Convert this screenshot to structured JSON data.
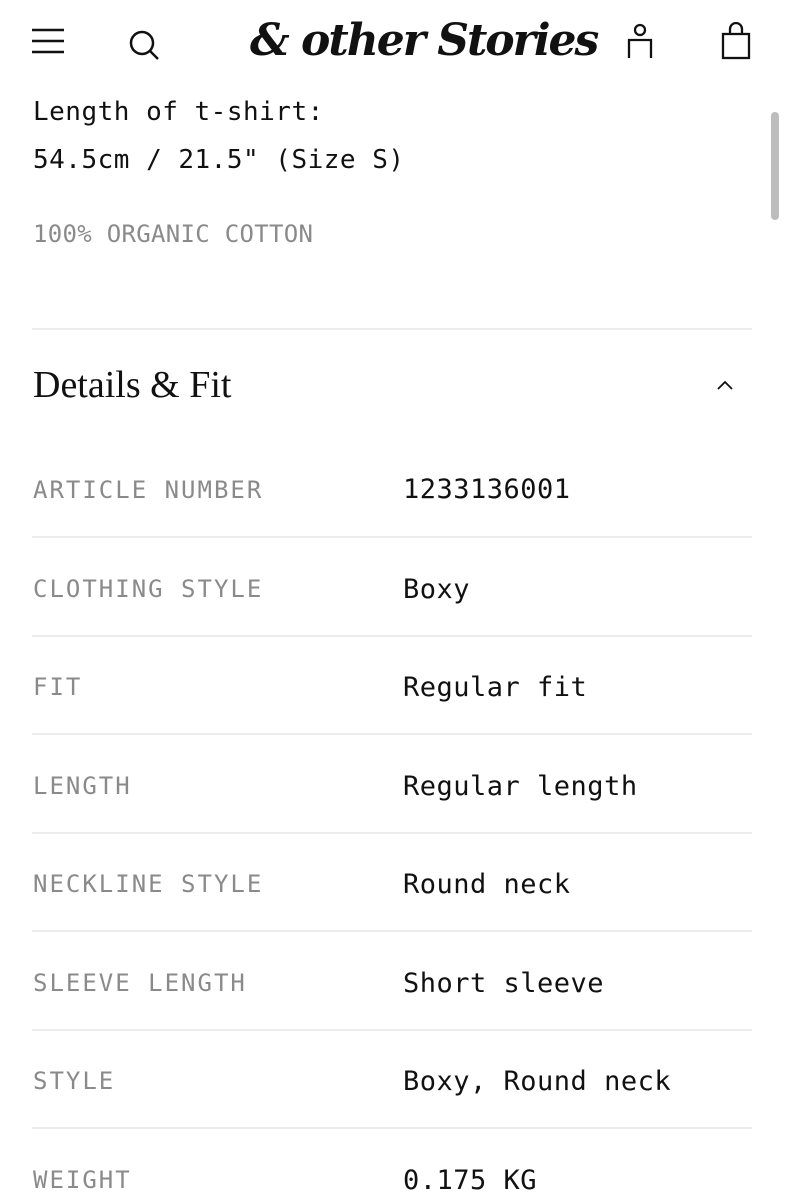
{
  "header": {
    "logo": "& other Stories",
    "icons": [
      "menu-icon",
      "search-icon",
      "account-icon",
      "shopping-bag-icon"
    ]
  },
  "intro": {
    "length_label": "Length of t-shirt:",
    "length_value": "54.5cm / 21.5\" (Size S)",
    "material": "100% ORGANIC COTTON"
  },
  "details": {
    "title": "Details & Fit",
    "toggle_icon": "chevron-up-icon",
    "rows": [
      {
        "label": "ARTICLE NUMBER",
        "value": "1233136001"
      },
      {
        "label": "CLOTHING STYLE",
        "value": "Boxy"
      },
      {
        "label": "FIT",
        "value": "Regular fit"
      },
      {
        "label": "LENGTH",
        "value": "Regular length"
      },
      {
        "label": "NECKLINE STYLE",
        "value": "Round neck"
      },
      {
        "label": "SLEEVE LENGTH",
        "value": "Short sleeve"
      },
      {
        "label": "STYLE",
        "value": "Boxy, Round neck"
      },
      {
        "label": "WEIGHT",
        "value": "0.175 KG"
      }
    ]
  }
}
